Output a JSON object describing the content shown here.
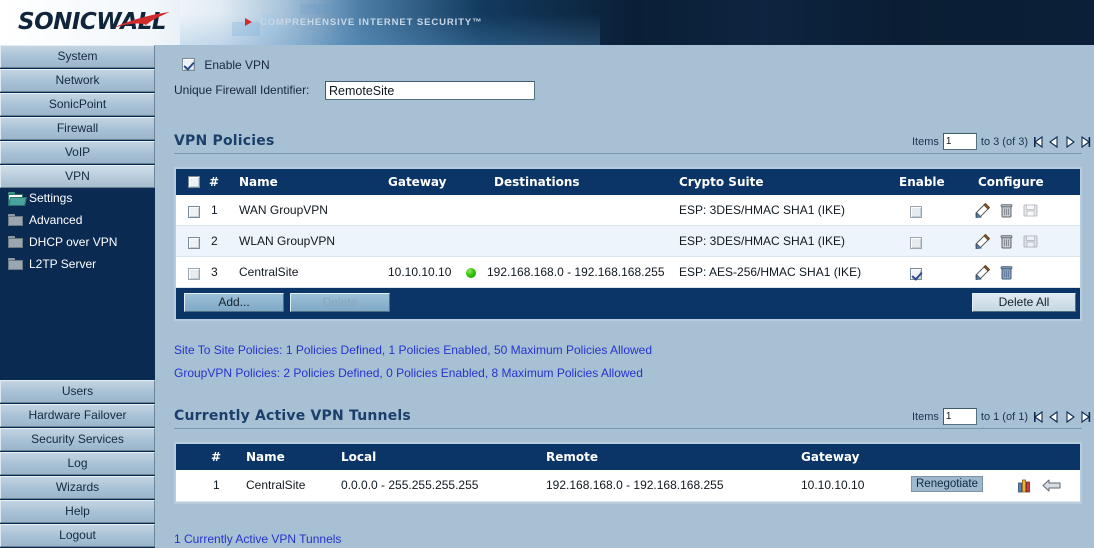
{
  "banner": {
    "logo": "SONICWALL",
    "tagline": "COMPREHENSIVE INTERNET SECURITY",
    "tagline_tm": "™"
  },
  "sidebar": {
    "top_items": [
      {
        "label": "System",
        "active": false
      },
      {
        "label": "Network",
        "active": false
      },
      {
        "label": "SonicPoint",
        "active": false
      },
      {
        "label": "Firewall",
        "active": false
      },
      {
        "label": "VoIP",
        "active": false
      },
      {
        "label": "VPN",
        "active": true
      }
    ],
    "sub_items": [
      {
        "label": "Settings",
        "icon": "folder-open-icon",
        "selected": true
      },
      {
        "label": "Advanced",
        "icon": "folder-icon",
        "selected": false
      },
      {
        "label": "DHCP over VPN",
        "icon": "folder-icon",
        "selected": false
      },
      {
        "label": "L2TP Server",
        "icon": "folder-icon",
        "selected": false
      }
    ],
    "bottom_items": [
      {
        "label": "Users"
      },
      {
        "label": "Hardware Failover"
      },
      {
        "label": "Security Services"
      },
      {
        "label": "Log"
      },
      {
        "label": "Wizards"
      },
      {
        "label": "Help"
      },
      {
        "label": "Logout"
      }
    ]
  },
  "form": {
    "enable_vpn_label": "Enable VPN",
    "enable_vpn_checked": true,
    "identifier_label": "Unique Firewall Identifier:",
    "identifier_value": "RemoteSite"
  },
  "policies_section": {
    "title": "VPN Policies",
    "pager": {
      "items_label": "Items",
      "start_value": "1",
      "range_label": "to 3 (of 3)"
    },
    "columns": [
      "#",
      "Name",
      "Gateway",
      "Destinations",
      "Crypto Suite",
      "Enable",
      "Configure"
    ],
    "rows": [
      {
        "num": "1",
        "name": "WAN GroupVPN",
        "gateway": "",
        "gateway_status": false,
        "destinations": "",
        "crypto": "ESP: 3DES/HMAC SHA1 (IKE)",
        "enabled": false,
        "enable_disabled": true,
        "icons": [
          "edit-icon",
          "delete-icon",
          "export-icon"
        ],
        "export_disabled": true
      },
      {
        "num": "2",
        "name": "WLAN GroupVPN",
        "gateway": "",
        "gateway_status": false,
        "destinations": "",
        "crypto": "ESP: 3DES/HMAC SHA1 (IKE)",
        "enabled": false,
        "enable_disabled": true,
        "icons": [
          "edit-icon",
          "delete-icon",
          "export-icon"
        ],
        "export_disabled": true
      },
      {
        "num": "3",
        "name": "CentralSite",
        "gateway": "10.10.10.10",
        "gateway_status": true,
        "destinations": "192.168.168.0 - 192.168.168.255",
        "crypto": "ESP: AES-256/HMAC SHA1 (IKE)",
        "enabled": true,
        "enable_disabled": false,
        "icons": [
          "edit-icon",
          "delete-icon"
        ],
        "export_disabled": false
      }
    ],
    "buttons": {
      "add": "Add...",
      "delete": "Delete",
      "delete_all": "Delete All"
    },
    "stats": [
      "Site To Site Policies:  1 Policies Defined, 1 Policies Enabled, 50 Maximum Policies Allowed",
      "GroupVPN Policies:  2 Policies Defined, 0 Policies Enabled, 8 Maximum Policies Allowed"
    ]
  },
  "tunnels_section": {
    "title": "Currently Active VPN Tunnels",
    "pager": {
      "items_label": "Items",
      "start_value": "1",
      "range_label": "to 1 (of 1)"
    },
    "columns": [
      "#",
      "Name",
      "Local",
      "Remote",
      "Gateway"
    ],
    "rows": [
      {
        "num": "1",
        "name": "CentralSite",
        "local": "0.0.0.0 - 255.255.255.255",
        "remote": "192.168.168.0 - 192.168.168.255",
        "gateway": "10.10.10.10",
        "action_label": "Renegotiate",
        "icons": [
          "statistics-icon",
          "arrow-left-icon"
        ]
      }
    ],
    "footer_note": "1 Currently Active VPN Tunnels"
  },
  "colors": {
    "header_navy": "#0b3566",
    "page_bg": "#a8c0d4",
    "link_blue": "#2633cf",
    "status_green": "#34c40a",
    "title_blue": "#1b3f6b"
  }
}
